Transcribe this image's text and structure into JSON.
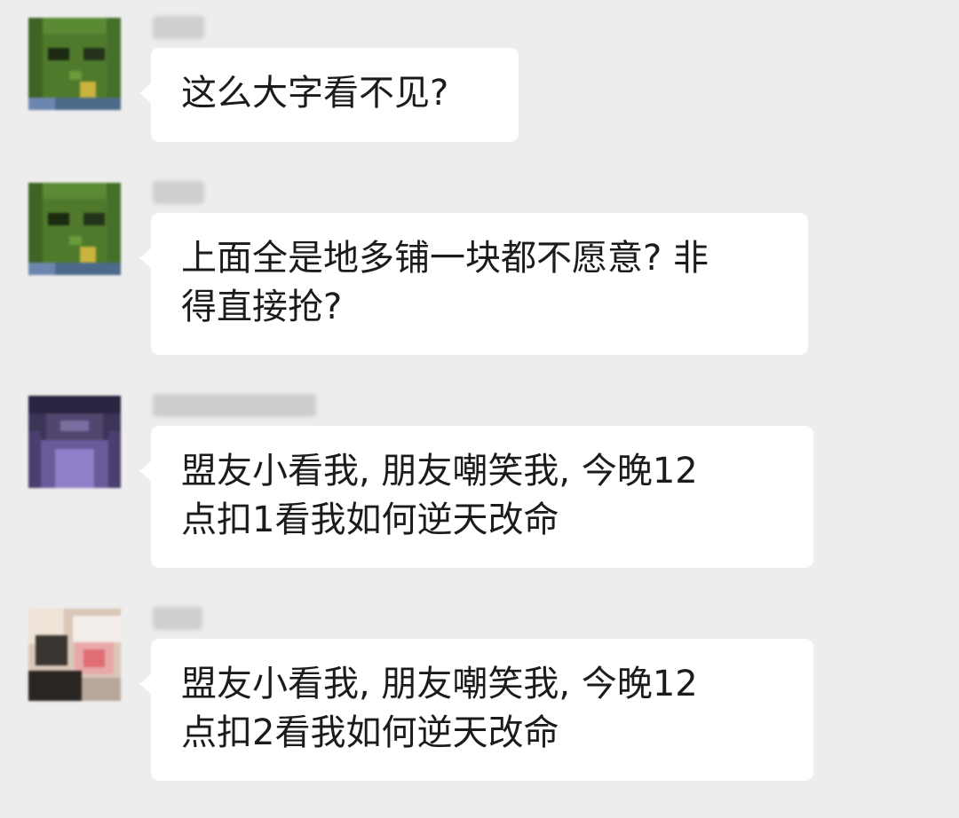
{
  "messages": [
    {
      "sender_name": "",
      "avatar_icon": "green-pixel-avatar-icon",
      "text": "这么大字看不见?"
    },
    {
      "sender_name": "",
      "avatar_icon": "green-pixel-avatar-icon",
      "text": "上面全是地多铺一块都不愿意? 非\n得直接抢?"
    },
    {
      "sender_name": "",
      "avatar_icon": "purple-pixel-avatar-icon",
      "text": "盟友小看我, 朋友嘲笑我, 今晚12\n点扣1看我如何逆天改命"
    },
    {
      "sender_name": "",
      "avatar_icon": "photo-pixel-avatar-icon",
      "text": "盟友小看我, 朋友嘲笑我, 今晚12\n点扣2看我如何逆天改命"
    }
  ],
  "colors": {
    "background": "#ededed",
    "bubble": "#ffffff",
    "text": "#1b1b1b",
    "blurred_name": "#c9c9c9"
  }
}
